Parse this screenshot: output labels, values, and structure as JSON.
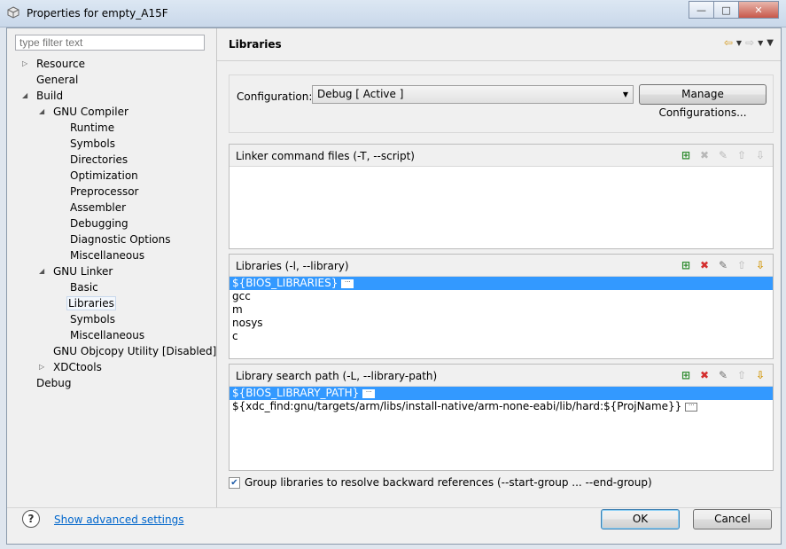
{
  "window": {
    "title": "Properties for empty_A15F",
    "btn_minimize": "—",
    "btn_maximize": "□",
    "btn_close": "✕"
  },
  "filter": {
    "placeholder": "type filter text"
  },
  "tree": {
    "resource": "Resource",
    "general": "General",
    "build": "Build",
    "gnu_compiler": "GNU Compiler",
    "runtime": "Runtime",
    "symbols": "Symbols",
    "directories": "Directories",
    "optimization": "Optimization",
    "preprocessor": "Preprocessor",
    "assembler": "Assembler",
    "debugging": "Debugging",
    "diagnostic_options": "Diagnostic Options",
    "miscellaneous": "Miscellaneous",
    "gnu_linker": "GNU Linker",
    "basic": "Basic",
    "libraries": "Libraries",
    "linker_symbols": "Symbols",
    "linker_misc": "Miscellaneous",
    "objcopy": "GNU Objcopy Utility  [Disabled]",
    "xdctools": "XDCtools",
    "debug": "Debug"
  },
  "page": {
    "title": "Libraries",
    "configuration_label": "Configuration:",
    "configuration_value": "Debug  [ Active ]",
    "manage_button": "Manage Configurations..."
  },
  "groups": {
    "linker_cmd": {
      "title": "Linker command files (-T, --script)",
      "items": []
    },
    "libraries": {
      "title": "Libraries (-l, --library)",
      "items": [
        "${BIOS_LIBRARIES}",
        "gcc",
        "m",
        "nosys",
        "c"
      ]
    },
    "search_path": {
      "title": "Library search path (-L, --library-path)",
      "items": [
        "${BIOS_LIBRARY_PATH}",
        "${xdc_find:gnu/targets/arm/libs/install-native/arm-none-eabi/lib/hard:${ProjName}}"
      ]
    }
  },
  "group_libs_checkbox": {
    "label": "Group libraries to resolve backward references (--start-group ... --end-group)",
    "checked": true
  },
  "footer": {
    "help": "?",
    "advanced_link": "Show advanced settings",
    "ok": "OK",
    "cancel": "Cancel"
  },
  "nav": {
    "back": "⇦",
    "forward": "⇨",
    "menu": "▼"
  },
  "colors": {
    "selection": "#3399ff",
    "link": "#0066cc",
    "title_bar": "#c9d8ea"
  }
}
